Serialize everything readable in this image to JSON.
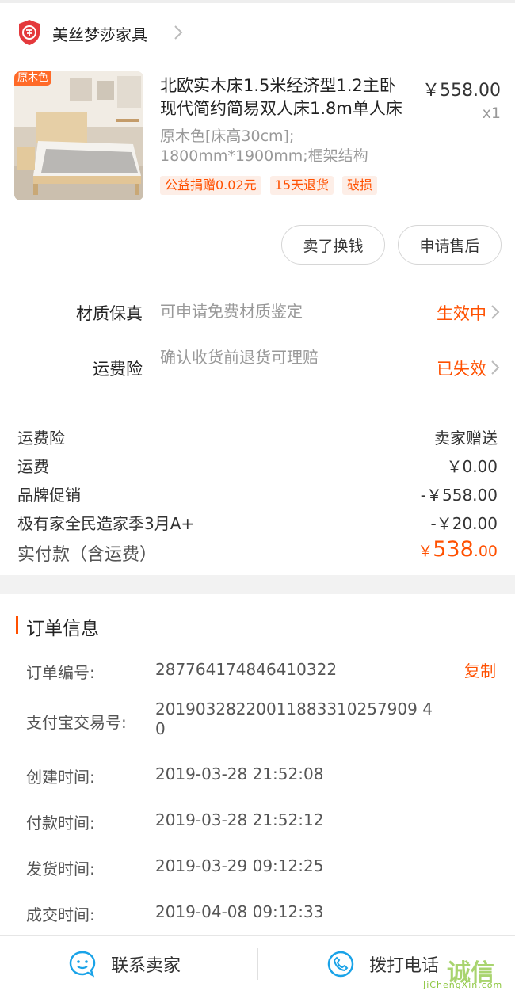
{
  "shop": {
    "name": "美丝梦莎家具",
    "logo_icon": "enterprise-badge-icon",
    "chevron_icon": "chevron-right-icon"
  },
  "product": {
    "image_badge": "原木色",
    "title": "北欧实木床1.5米经济型1.2主卧现代简约简易双人床1.8m单人床",
    "price": "￥558.00",
    "quantity": "x1",
    "sku": "原木色[床高30cm]; 1800mm*1900mm;框架结构",
    "tags": [
      "公益捐赠0.02元",
      "15天退货",
      "破损"
    ]
  },
  "actions": {
    "sell_label": "卖了换钱",
    "after_sale_label": "申请售后"
  },
  "services": [
    {
      "label": "材质保真",
      "desc": "可申请免费材质鉴定",
      "status": "生效中"
    },
    {
      "label": "运费险",
      "desc": "确认收货前退货可理赔",
      "status": "已失效"
    }
  ],
  "fees": [
    {
      "label": "运费险",
      "value": "卖家赠送"
    },
    {
      "label": "运费",
      "value": "￥0.00"
    },
    {
      "label": "品牌促销",
      "value": "-￥558.00"
    },
    {
      "label": "极有家全民造家季3月A+",
      "value": "-￥20.00"
    }
  ],
  "total": {
    "label": "实付款（含运费）",
    "currency": "￥",
    "integer": "538",
    "decimal": ".00"
  },
  "order_info": {
    "title": "订单信息",
    "copy_label": "复制",
    "rows": [
      {
        "key": "订单编号:",
        "value": "287764174846410322"
      },
      {
        "key": "支付宝交易号:",
        "value": "20190328220011883310257909 40"
      },
      {
        "key": "创建时间:",
        "value": "2019-03-28 21:52:08"
      },
      {
        "key": "付款时间:",
        "value": "2019-03-28 21:52:12"
      },
      {
        "key": "发货时间:",
        "value": "2019-03-29 09:12:25"
      },
      {
        "key": "成交时间:",
        "value": "2019-04-08 09:12:33"
      }
    ]
  },
  "bottom_bar": {
    "contact_label": "联系卖家",
    "call_label": "拨打电话",
    "contact_icon": "chat-bubble-icon",
    "call_icon": "phone-icon"
  },
  "watermark": {
    "glyphs": "诚信",
    "text": "JiChengXin.com"
  },
  "colors": {
    "accent": "#ff5000",
    "tag_bg": "#fdeee7",
    "muted": "#999999"
  }
}
